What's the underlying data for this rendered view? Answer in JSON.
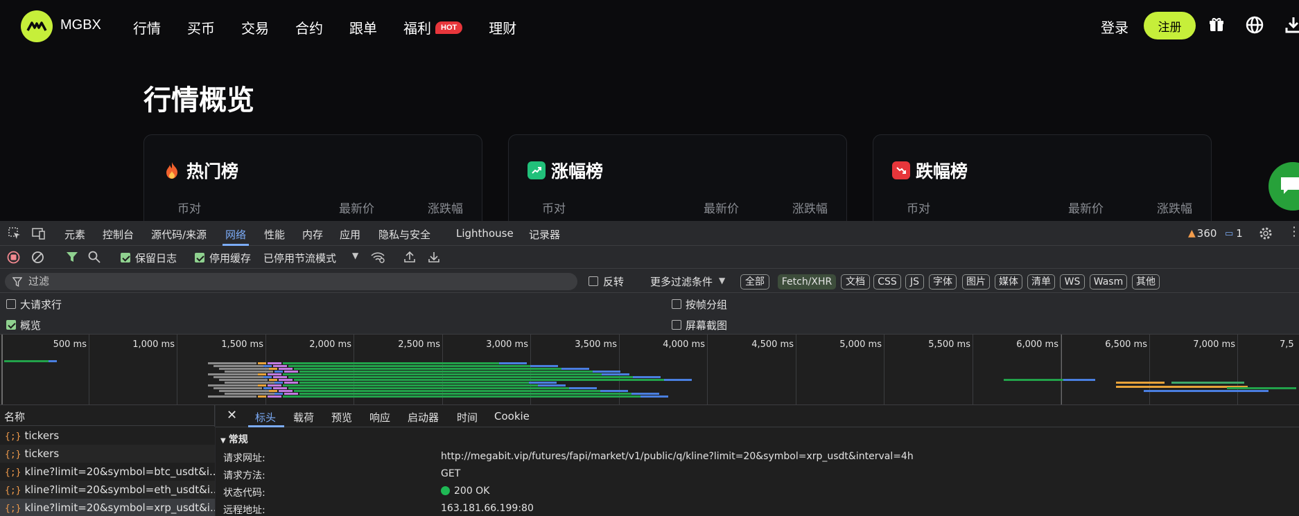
{
  "header": {
    "brand": "MGBX",
    "nav": [
      {
        "label": "行情"
      },
      {
        "label": "买币"
      },
      {
        "label": "交易"
      },
      {
        "label": "合约"
      },
      {
        "label": "跟单"
      },
      {
        "label": "福利",
        "badge": "HOT"
      },
      {
        "label": "理财"
      }
    ],
    "login": "登录",
    "register": "注册",
    "icons": [
      "gift-icon",
      "globe-icon",
      "download-icon"
    ]
  },
  "market": {
    "title": "行情概览",
    "cards": [
      {
        "title": "热门榜",
        "icon": "fire-icon",
        "cols": [
          "币对",
          "最新价",
          "涨跌幅"
        ]
      },
      {
        "title": "涨幅榜",
        "icon": "trending-up-icon",
        "cols": [
          "币对",
          "最新价",
          "涨跌幅"
        ]
      },
      {
        "title": "跌幅榜",
        "icon": "trending-down-icon",
        "cols": [
          "币对",
          "最新价",
          "涨跌幅"
        ]
      }
    ]
  },
  "devtools": {
    "tabs": [
      "元素",
      "控制台",
      "源代码/来源",
      "网络",
      "性能",
      "内存",
      "应用",
      "隐私与安全",
      "Lighthouse",
      "记录器"
    ],
    "active_tab": "网络",
    "warnings": "360",
    "messages": "1",
    "toolbar": {
      "preserve_log": "保留日志",
      "disable_cache": "停用缓存",
      "throttle": "已停用节流模式"
    },
    "filter": {
      "placeholder": "过滤",
      "invert": "反转",
      "more": "更多过滤条件",
      "types": [
        "全部",
        "Fetch/XHR",
        "文档",
        "CSS",
        "JS",
        "字体",
        "图片",
        "媒体",
        "清单",
        "WS",
        "Wasm",
        "其他"
      ],
      "selected_type": "Fetch/XHR"
    },
    "options": {
      "big_rows": "大请求行",
      "group_frames": "按帧分组",
      "overview": "概览",
      "screenshots": "屏幕截图"
    },
    "timeline_ticks": [
      "500 ms",
      "1,000 ms",
      "1,500 ms",
      "2,000 ms",
      "2,500 ms",
      "3,000 ms",
      "3,500 ms",
      "4,000 ms",
      "4,500 ms",
      "5,000 ms",
      "5,500 ms",
      "6,000 ms",
      "6,500 ms",
      "7,000 ms",
      "7,5"
    ],
    "list_header": "名称",
    "requests": [
      "tickers",
      "tickers",
      "kline?limit=20&symbol=btc_usdt&i...",
      "kline?limit=20&symbol=eth_usdt&i...",
      "kline?limit=20&symbol=xrp_usdt&i..."
    ],
    "detail_tabs": [
      "标头",
      "载荷",
      "预览",
      "响应",
      "启动器",
      "时间",
      "Cookie"
    ],
    "detail_active": "标头",
    "general_section": "常规",
    "general": [
      {
        "key": "请求网址:",
        "value": "http://megabit.vip/futures/fapi/market/v1/public/q/kline?limit=20&symbol=xrp_usdt&interval=4h"
      },
      {
        "key": "请求方法:",
        "value": "GET"
      },
      {
        "key": "状态代码:",
        "value": "200 OK"
      },
      {
        "key": "远程地址:",
        "value": "163.181.66.199:80"
      }
    ]
  },
  "colors": {
    "accent": "#c6ef3a",
    "hot": "#e8363b",
    "up": "#21c07a",
    "down": "#e8363b",
    "devtools_blue": "#7cacf8"
  }
}
